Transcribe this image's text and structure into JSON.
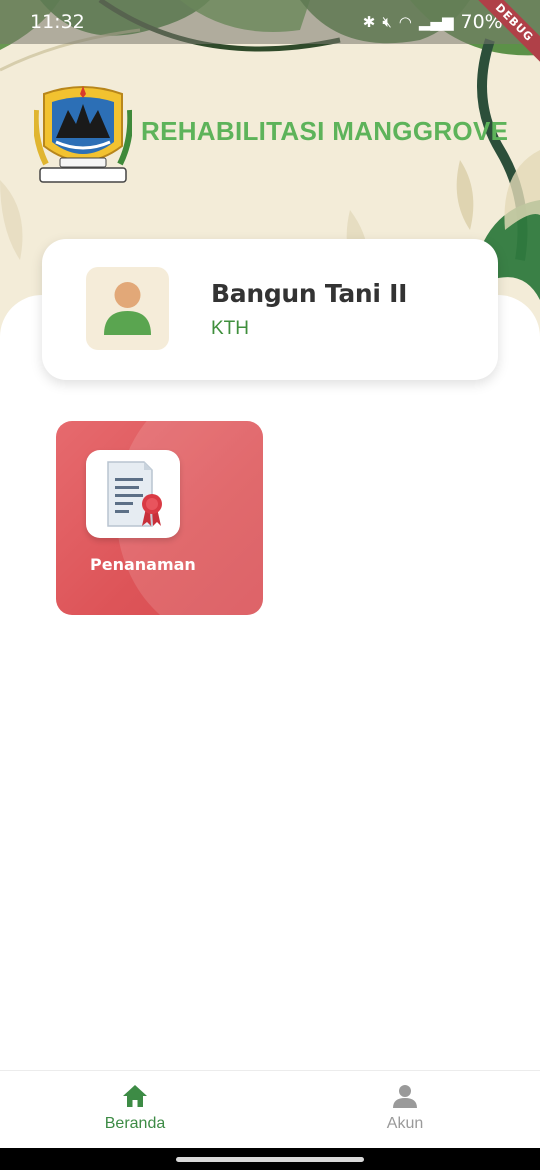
{
  "status_bar": {
    "time": "11:32",
    "battery": "70%",
    "icons": [
      "bluetooth-icon",
      "mute-icon",
      "wifi-icon",
      "signal-icon",
      "battery-icon"
    ]
  },
  "debug_banner": "DEBUG",
  "header": {
    "title": "REHABILITASI MANGGROVE",
    "logo": "jawa-tengah-emblem",
    "title_color": "#5db35a"
  },
  "profile": {
    "name": "Bangun Tani II",
    "role": "KTH",
    "avatar_icon": "person-icon",
    "role_color": "#3f8f3c"
  },
  "menu": [
    {
      "label": "Penanaman",
      "icon": "certificate-document-icon",
      "color": "#dd5458"
    }
  ],
  "bottom_nav": {
    "items": [
      {
        "label": "Beranda",
        "icon": "home-icon",
        "active": true
      },
      {
        "label": "Akun",
        "icon": "account-icon",
        "active": false
      }
    ],
    "active_color": "#3d8b45",
    "inactive_color": "#9a9a9a"
  }
}
